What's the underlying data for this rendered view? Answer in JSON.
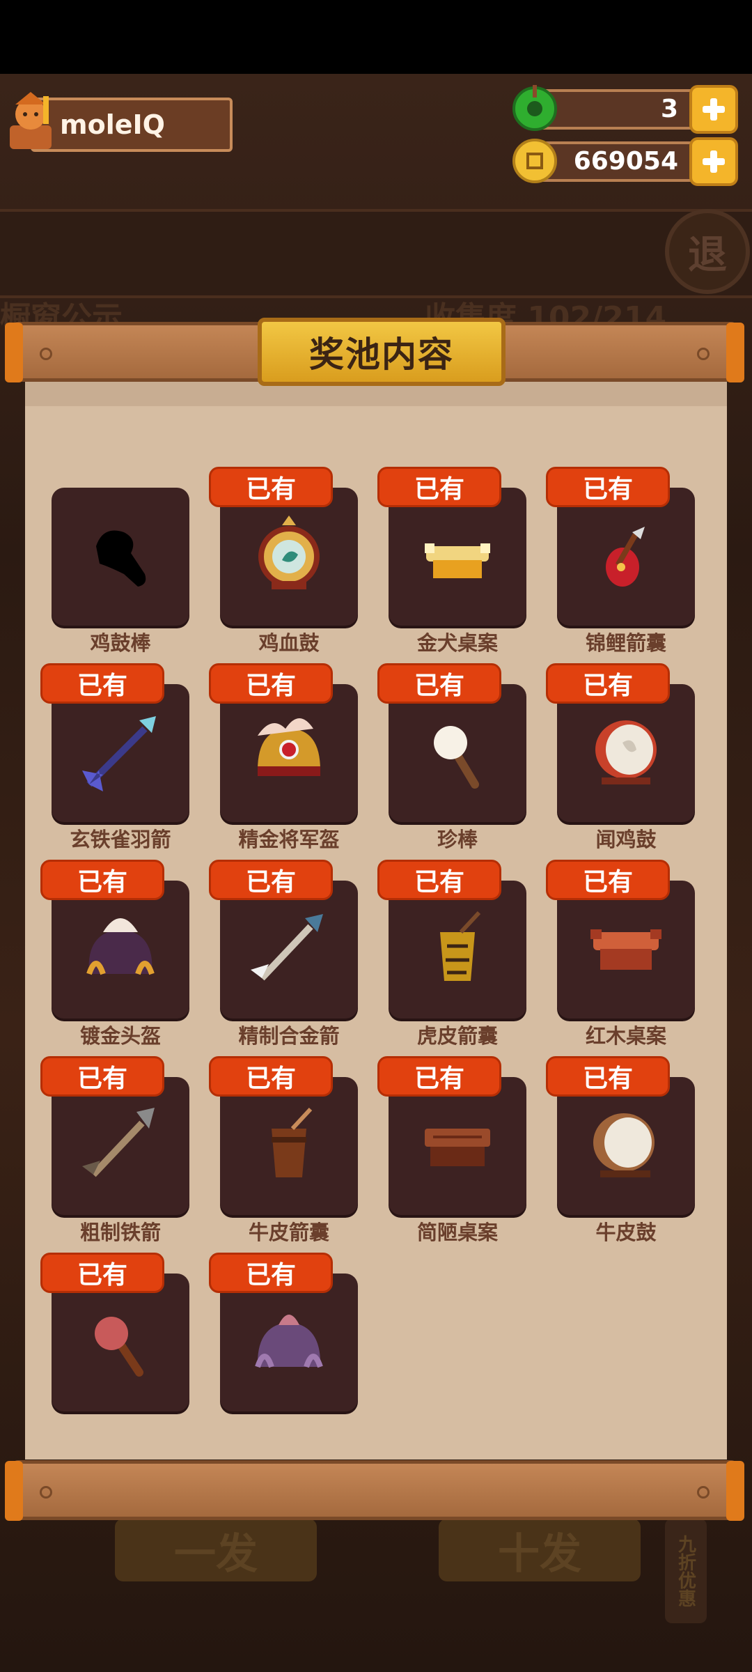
{
  "player": {
    "name": "moleIQ"
  },
  "currencies": [
    {
      "name": "jade",
      "value": "3"
    },
    {
      "name": "coins",
      "value": "669054"
    }
  ],
  "modal": {
    "title": "奖池内容"
  },
  "badge_label": "已有",
  "items": [
    {
      "name": "鸡鼓棒",
      "owned": false,
      "icon": "silhouette-icon"
    },
    {
      "name": "鸡血鼓",
      "owned": true,
      "icon": "ornate-drum-icon"
    },
    {
      "name": "金犬桌案",
      "owned": true,
      "icon": "golden-table-icon"
    },
    {
      "name": "锦鲤箭囊",
      "owned": true,
      "icon": "koi-quiver-icon"
    },
    {
      "name": "玄铁雀羽箭",
      "owned": true,
      "icon": "feather-arrow-icon"
    },
    {
      "name": "精金将军盔",
      "owned": true,
      "icon": "general-helmet-icon"
    },
    {
      "name": "珍棒",
      "owned": true,
      "icon": "pearl-stick-icon"
    },
    {
      "name": "闻鸡鼓",
      "owned": true,
      "icon": "rooster-drum-icon"
    },
    {
      "name": "镀金头盔",
      "owned": true,
      "icon": "gilded-helmet-icon"
    },
    {
      "name": "精制合金箭",
      "owned": true,
      "icon": "alloy-arrow-icon"
    },
    {
      "name": "虎皮箭囊",
      "owned": true,
      "icon": "tiger-quiver-icon"
    },
    {
      "name": "红木桌案",
      "owned": true,
      "icon": "redwood-table-icon"
    },
    {
      "name": "粗制铁箭",
      "owned": true,
      "icon": "iron-arrow-icon"
    },
    {
      "name": "牛皮箭囊",
      "owned": true,
      "icon": "leather-quiver-icon"
    },
    {
      "name": "简陋桌案",
      "owned": true,
      "icon": "crude-table-icon"
    },
    {
      "name": "牛皮鼓",
      "owned": true,
      "icon": "leather-drum-icon"
    },
    {
      "name": "",
      "owned": true,
      "icon": "red-mallet-icon"
    },
    {
      "name": "",
      "owned": true,
      "icon": "purple-helmet-icon"
    }
  ],
  "background": {
    "left_tab": "橱窗公示",
    "right_tab": "收集度 102/214",
    "exit_label": "退",
    "button_one": "一发",
    "button_ten": "十发",
    "promo_label": "九折优惠"
  },
  "colors": {
    "badge": "#e1410f",
    "item_bg": "#3d2222",
    "paper": "#d6bda2",
    "title_plate": "#f2c744",
    "plus_button": "#f4b52a"
  }
}
